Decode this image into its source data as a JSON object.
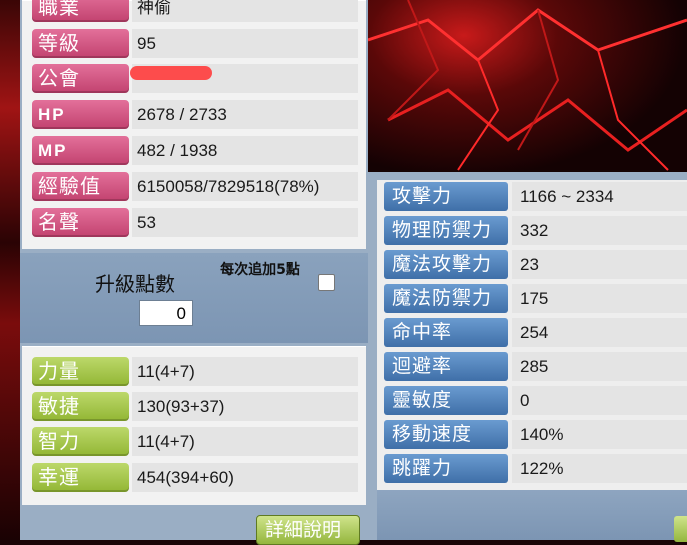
{
  "left_panel": {
    "rows_top": [
      {
        "label": "職業",
        "value": "神偷"
      },
      {
        "label": "等級",
        "value": "95"
      },
      {
        "label": "公會",
        "value": ""
      },
      {
        "label": "HP",
        "value": "2678 / 2733"
      },
      {
        "label": "MP",
        "value": "482 / 1938"
      },
      {
        "label": "經驗值",
        "value": "6150058/7829518(78%)"
      },
      {
        "label": "名聲",
        "value": "53"
      }
    ],
    "ap": {
      "label": "升級點數",
      "value": "0",
      "each_label": "每次追加5點"
    },
    "rows_bottom": [
      {
        "label": "力量",
        "value": "11(4+7)"
      },
      {
        "label": "敏捷",
        "value": "130(93+37)"
      },
      {
        "label": "智力",
        "value": "11(4+7)"
      },
      {
        "label": "幸運",
        "value": "454(394+60)"
      }
    ],
    "detail_button": "詳細說明"
  },
  "right_panel": {
    "rows": [
      {
        "label": "攻擊力",
        "value": "1166 ~ 2334"
      },
      {
        "label": "物理防禦力",
        "value": "332"
      },
      {
        "label": "魔法攻擊力",
        "value": "23"
      },
      {
        "label": "魔法防禦力",
        "value": "175"
      },
      {
        "label": "命中率",
        "value": "254"
      },
      {
        "label": "迴避率",
        "value": "285"
      },
      {
        "label": "靈敏度",
        "value": "0"
      },
      {
        "label": "移動速度",
        "value": "140%"
      },
      {
        "label": "跳躍力",
        "value": "122%"
      }
    ]
  },
  "colors": {
    "label_pink": "#d45582",
    "label_green": "#a6c64a",
    "label_blue": "#4f80bb",
    "panel_bg": "#9aaec4"
  }
}
